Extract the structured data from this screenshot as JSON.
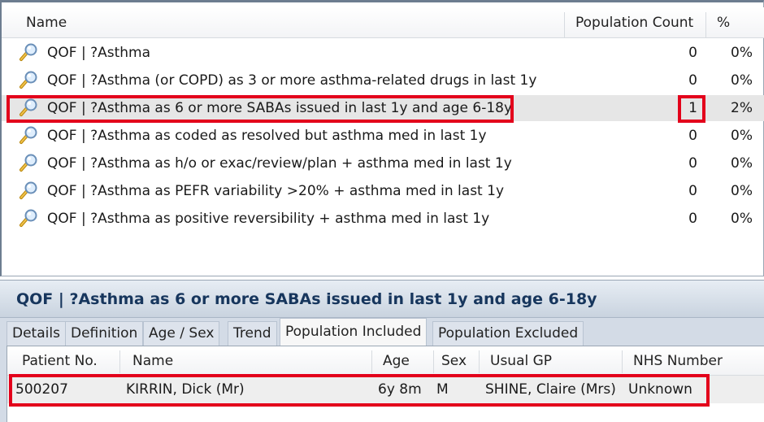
{
  "search_list": {
    "columns": {
      "name": "Name",
      "population_count": "Population Count",
      "percent": "%"
    },
    "rows": [
      {
        "name": "QOF | ?Asthma",
        "count": "0",
        "percent": "0%",
        "icon": "magnifier-icon"
      },
      {
        "name": "QOF | ?Asthma (or COPD) as 3 or more asthma-related drugs in last 1y",
        "count": "0",
        "percent": "0%",
        "icon": "magnifier-icon"
      },
      {
        "name": "QOF | ?Asthma as 6 or more SABAs issued in last 1y and age 6-18y",
        "count": "1",
        "percent": "2%",
        "icon": "magnifier-icon",
        "selected": true
      },
      {
        "name": "QOF | ?Asthma as coded as resolved but asthma med in last 1y",
        "count": "0",
        "percent": "0%",
        "icon": "magnifier-icon"
      },
      {
        "name": "QOF | ?Asthma as h/o or exac/review/plan + asthma med in last 1y",
        "count": "0",
        "percent": "0%",
        "icon": "magnifier-icon"
      },
      {
        "name": "QOF | ?Asthma as PEFR variability >20% + asthma med in last 1y",
        "count": "0",
        "percent": "0%",
        "icon": "magnifier-icon"
      },
      {
        "name": "QOF | ?Asthma as positive reversibility + asthma med in last 1y",
        "count": "0",
        "percent": "0%",
        "icon": "magnifier-icon"
      }
    ]
  },
  "detail": {
    "title": "QOF | ?Asthma as 6 or more SABAs issued in last 1y and age 6-18y",
    "tabs": [
      "Details",
      "Definition",
      "Age / Sex",
      "Trend",
      "Population Included",
      "Population Excluded"
    ],
    "active_tab": "Population Included",
    "patient_grid": {
      "columns": [
        "Patient No.",
        "Name",
        "Age",
        "Sex",
        "Usual GP",
        "NHS Number"
      ],
      "rows": [
        {
          "patient_no": "500207",
          "name": "KIRRIN, Dick (Mr)",
          "age": "6y 8m",
          "sex": "M",
          "usual_gp": "SHINE, Claire (Mrs)",
          "nhs_number": "Unknown"
        }
      ]
    }
  },
  "colors": {
    "highlight": "#e3001b",
    "title_text": "#17365d",
    "selected_row": "#e6e6e6"
  }
}
